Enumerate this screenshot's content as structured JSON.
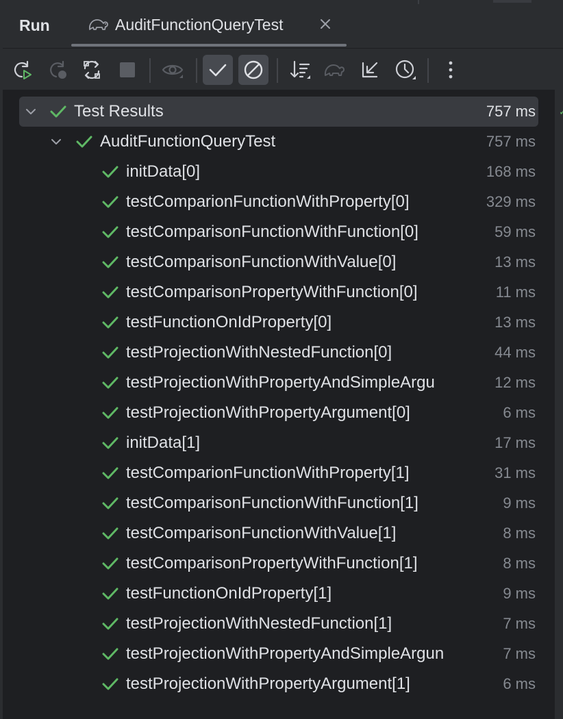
{
  "tool_window": {
    "title": "Run",
    "tab": {
      "title": "AuditFunctionQueryTest",
      "icon": "gradle-elephant-icon"
    }
  },
  "toolbar": {
    "buttons": [
      {
        "name": "rerun-button",
        "icon": "rerun-icon",
        "enabled": true,
        "active": false
      },
      {
        "name": "rerun-failed-button",
        "icon": "rerun-failed-icon",
        "enabled": false,
        "active": false
      },
      {
        "name": "toggle-auto-test-button",
        "icon": "toggle-auto-test-icon",
        "enabled": true,
        "active": false
      },
      {
        "name": "stop-button",
        "icon": "stop-icon",
        "enabled": false,
        "active": false
      },
      {
        "name": "show-ignored-button",
        "icon": "eye-icon",
        "enabled": false,
        "active": false
      },
      {
        "name": "show-passed-button",
        "icon": "check-icon",
        "enabled": true,
        "active": true
      },
      {
        "name": "show-ignored-tests-button",
        "icon": "no-entry-icon",
        "enabled": true,
        "active": true
      },
      {
        "name": "sort-button",
        "icon": "sort-icon",
        "enabled": true,
        "active": false
      },
      {
        "name": "gradle-button",
        "icon": "gradle-elephant-icon",
        "enabled": false,
        "active": false
      },
      {
        "name": "import-tests-button",
        "icon": "import-arrow-icon",
        "enabled": true,
        "active": false
      },
      {
        "name": "history-button",
        "icon": "clock-icon",
        "enabled": true,
        "active": false
      },
      {
        "name": "more-options-button",
        "icon": "more-vertical-icon",
        "enabled": true,
        "active": false
      }
    ]
  },
  "tree": {
    "root": {
      "label": "Test Results",
      "time": "757 ms",
      "status": "passed"
    },
    "suite": {
      "label": "AuditFunctionQueryTest",
      "time": "757 ms",
      "status": "passed"
    },
    "tests": [
      {
        "label": "initData[0]",
        "time": "168 ms"
      },
      {
        "label": "testComparionFunctionWithProperty[0]",
        "time": "329 ms"
      },
      {
        "label": "testComparisonFunctionWithFunction[0]",
        "time": "59 ms"
      },
      {
        "label": "testComparisonFunctionWithValue[0]",
        "time": "13 ms"
      },
      {
        "label": "testComparisonPropertyWithFunction[0]",
        "time": "11 ms"
      },
      {
        "label": "testFunctionOnIdProperty[0]",
        "time": "13 ms"
      },
      {
        "label": "testProjectionWithNestedFunction[0]",
        "time": "44 ms"
      },
      {
        "label": "testProjectionWithPropertyAndSimpleArgu",
        "time": "12 ms"
      },
      {
        "label": "testProjectionWithPropertyArgument[0]",
        "time": "6 ms"
      },
      {
        "label": "initData[1]",
        "time": "17 ms"
      },
      {
        "label": "testComparionFunctionWithProperty[1]",
        "time": "31 ms"
      },
      {
        "label": "testComparisonFunctionWithFunction[1]",
        "time": "9 ms"
      },
      {
        "label": "testComparisonFunctionWithValue[1]",
        "time": "8 ms"
      },
      {
        "label": "testComparisonPropertyWithFunction[1]",
        "time": "8 ms"
      },
      {
        "label": "testFunctionOnIdProperty[1]",
        "time": "9 ms"
      },
      {
        "label": "testProjectionWithNestedFunction[1]",
        "time": "7 ms"
      },
      {
        "label": "testProjectionWithPropertyAndSimpleArgun",
        "time": "7 ms"
      },
      {
        "label": "testProjectionWithPropertyArgument[1]",
        "time": "6 ms"
      }
    ]
  },
  "colors": {
    "background": "#2b2d30",
    "tree_background": "#1e1f22",
    "selection": "#393b40",
    "pass_green": "#5fb865",
    "text": "#dfe1e5",
    "muted_text": "#868a91"
  }
}
